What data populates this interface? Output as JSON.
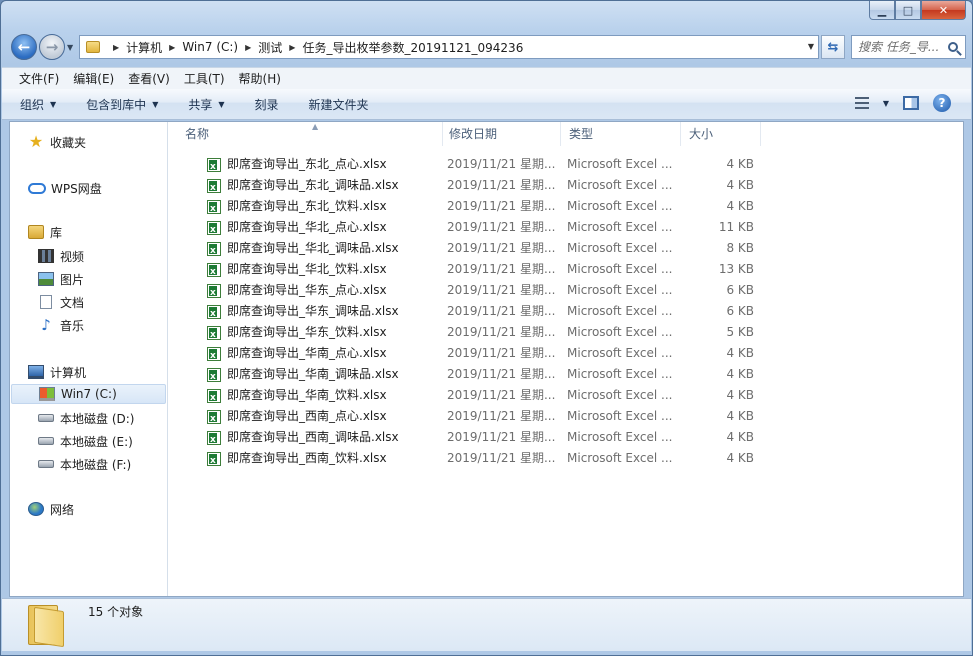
{
  "window": {
    "caption": {
      "min": "▁",
      "max": "□",
      "close": "✕"
    }
  },
  "address": {
    "breadcrumbs": [
      "计算机",
      "Win7 (C:)",
      "测试",
      "任务_导出枚举参数_20191121_094236"
    ]
  },
  "search": {
    "placeholder": "搜索 任务_导..."
  },
  "menu": [
    "文件(F)",
    "编辑(E)",
    "查看(V)",
    "工具(T)",
    "帮助(H)"
  ],
  "toolbar": {
    "organize": "组织",
    "include_library": "包含到库中",
    "share": "共享",
    "burn": "刻录",
    "new_folder": "新建文件夹"
  },
  "nav": {
    "favorites": "收藏夹",
    "wps": "WPS网盘",
    "library": "库",
    "video": "视频",
    "pictures": "图片",
    "documents": "文档",
    "music": "音乐",
    "computer": "计算机",
    "drive_c": "Win7 (C:)",
    "drive_d": "本地磁盘 (D:)",
    "drive_e": "本地磁盘 (E:)",
    "drive_f": "本地磁盘 (F:)",
    "network": "网络"
  },
  "columns": {
    "name": "名称",
    "date": "修改日期",
    "type": "类型",
    "size": "大小"
  },
  "files": [
    {
      "name": "即席查询导出_东北_点心.xlsx",
      "date": "2019/11/21 星期...",
      "type": "Microsoft Excel ...",
      "size": "4 KB"
    },
    {
      "name": "即席查询导出_东北_调味品.xlsx",
      "date": "2019/11/21 星期...",
      "type": "Microsoft Excel ...",
      "size": "4 KB"
    },
    {
      "name": "即席查询导出_东北_饮料.xlsx",
      "date": "2019/11/21 星期...",
      "type": "Microsoft Excel ...",
      "size": "4 KB"
    },
    {
      "name": "即席查询导出_华北_点心.xlsx",
      "date": "2019/11/21 星期...",
      "type": "Microsoft Excel ...",
      "size": "11 KB"
    },
    {
      "name": "即席查询导出_华北_调味品.xlsx",
      "date": "2019/11/21 星期...",
      "type": "Microsoft Excel ...",
      "size": "8 KB"
    },
    {
      "name": "即席查询导出_华北_饮料.xlsx",
      "date": "2019/11/21 星期...",
      "type": "Microsoft Excel ...",
      "size": "13 KB"
    },
    {
      "name": "即席查询导出_华东_点心.xlsx",
      "date": "2019/11/21 星期...",
      "type": "Microsoft Excel ...",
      "size": "6 KB"
    },
    {
      "name": "即席查询导出_华东_调味品.xlsx",
      "date": "2019/11/21 星期...",
      "type": "Microsoft Excel ...",
      "size": "6 KB"
    },
    {
      "name": "即席查询导出_华东_饮料.xlsx",
      "date": "2019/11/21 星期...",
      "type": "Microsoft Excel ...",
      "size": "5 KB"
    },
    {
      "name": "即席查询导出_华南_点心.xlsx",
      "date": "2019/11/21 星期...",
      "type": "Microsoft Excel ...",
      "size": "4 KB"
    },
    {
      "name": "即席查询导出_华南_调味品.xlsx",
      "date": "2019/11/21 星期...",
      "type": "Microsoft Excel ...",
      "size": "4 KB"
    },
    {
      "name": "即席查询导出_华南_饮料.xlsx",
      "date": "2019/11/21 星期...",
      "type": "Microsoft Excel ...",
      "size": "4 KB"
    },
    {
      "name": "即席查询导出_西南_点心.xlsx",
      "date": "2019/11/21 星期...",
      "type": "Microsoft Excel ...",
      "size": "4 KB"
    },
    {
      "name": "即席查询导出_西南_调味品.xlsx",
      "date": "2019/11/21 星期...",
      "type": "Microsoft Excel ...",
      "size": "4 KB"
    },
    {
      "name": "即席查询导出_西南_饮料.xlsx",
      "date": "2019/11/21 星期...",
      "type": "Microsoft Excel ...",
      "size": "4 KB"
    }
  ],
  "status": {
    "count": "15 个对象"
  }
}
